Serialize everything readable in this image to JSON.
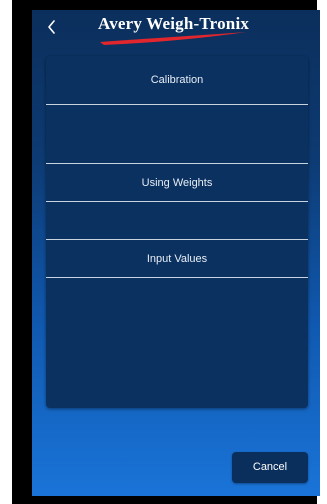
{
  "header": {
    "brand_name": "Avery Weigh-Tronix",
    "back_icon": "chevron-left-icon",
    "swoosh_color": "#e1262d"
  },
  "menu": {
    "section_heading": "Calibration",
    "items": [
      {
        "label": "Using Weights"
      },
      {
        "label": "Input Values"
      }
    ]
  },
  "footer": {
    "cancel_label": "Cancel"
  },
  "colors": {
    "panel": "#0b3160",
    "background_top": "#0b2f5c",
    "background_bottom": "#1a74d8"
  }
}
